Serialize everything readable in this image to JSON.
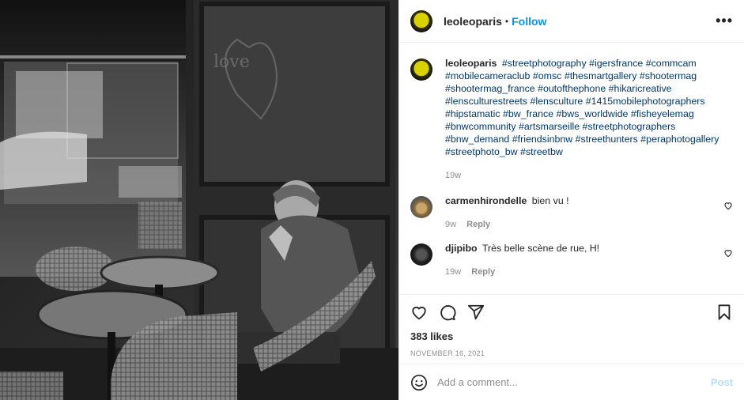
{
  "post": {
    "username": "leoleoparis",
    "follow_label": "Follow",
    "separator": "•",
    "more_label": "•••",
    "caption": {
      "username": "leoleoparis",
      "text": "#streetphotography #igersfrance #commcam #mobilecameraclub #omsc #thesmartgallery #shootermag #shootermag_france #outofthephone #hikaricreative #lensculturestreets #lensculture #1415mobilephotographers #hipstamatic #bw_france #bws_worldwide #fisheyelemag #bnwcommunity #artsmarseille #streetphotographers #bnw_demand #friendsinbnw #streethunters #peraphotogallery #streetphoto_bw #streetbw",
      "time": "19w"
    },
    "comments": [
      {
        "username": "carmenhirondelle",
        "text": "bien vu !",
        "time": "9w",
        "reply_label": "Reply"
      },
      {
        "username": "djipibo",
        "text": "Très belle scène de rue, H!",
        "time": "19w",
        "reply_label": "Reply"
      }
    ],
    "likes": "383 likes",
    "date": "NOVEMBER 16, 2021",
    "add_comment_placeholder": "Add a comment...",
    "post_label": "Post"
  },
  "icons": {
    "like": "heart-icon",
    "comment": "comment-icon",
    "share": "paper-plane-icon",
    "save": "bookmark-icon",
    "emoji": "smiley-icon"
  },
  "colors": {
    "follow_blue": "#0095f6",
    "hashtag": "#00376b",
    "muted": "#8e8e8e",
    "post_disabled": "#b2dffc"
  }
}
